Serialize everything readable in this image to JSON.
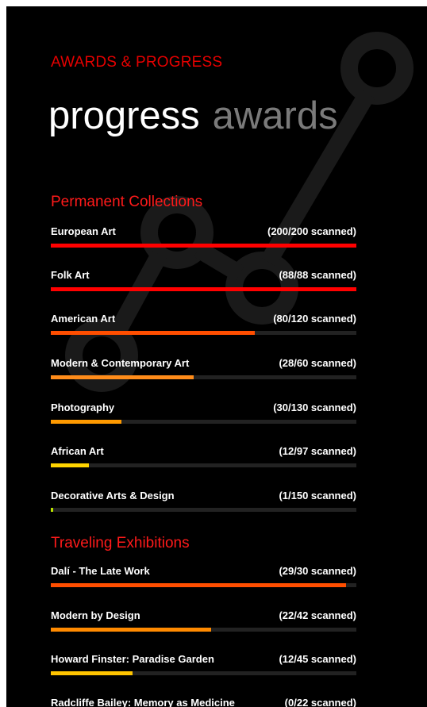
{
  "app_title": "AWARDS & PROGRESS",
  "pivot": {
    "active": "progress",
    "inactive": "awards"
  },
  "sections": [
    {
      "header": "Permanent Collections",
      "items": [
        {
          "name": "European Art",
          "count": "(200/200 scanned)",
          "progress": 1.0,
          "color": "#ff0000"
        },
        {
          "name": "Folk Art",
          "count": "(88/88 scanned)",
          "progress": 1.0,
          "color": "#ff0000"
        },
        {
          "name": "American Art",
          "count": "(80/120 scanned)",
          "progress": 0.667,
          "color": "#ff4e00"
        },
        {
          "name": "Modern & Contemporary Art",
          "count": "(28/60 scanned)",
          "progress": 0.467,
          "color": "#ff8c1a"
        },
        {
          "name": "Photography",
          "count": "(30/130 scanned)",
          "progress": 0.231,
          "color": "#ff9a00"
        },
        {
          "name": "African Art",
          "count": "(12/97 scanned)",
          "progress": 0.124,
          "color": "#ffd400"
        },
        {
          "name": "Decorative Arts & Design",
          "count": "(1/150 scanned)",
          "progress": 0.007,
          "color": "#b9e000"
        }
      ]
    },
    {
      "header": "Traveling Exhibitions",
      "items": [
        {
          "name": "Dalí - The Late Work",
          "count": "(29/30 scanned)",
          "progress": 0.967,
          "color": "#ff4e00"
        },
        {
          "name": "Modern by Design",
          "count": "(22/42 scanned)",
          "progress": 0.524,
          "color": "#ff8a00"
        },
        {
          "name": "Howard Finster: Paradise Garden",
          "count": "(12/45 scanned)",
          "progress": 0.267,
          "color": "#ffc400"
        },
        {
          "name": "Radcliffe Bailey: Memory as Medicine",
          "count": "(0/22 scanned)",
          "progress": 0.0,
          "color": "#ffc400"
        }
      ]
    }
  ]
}
